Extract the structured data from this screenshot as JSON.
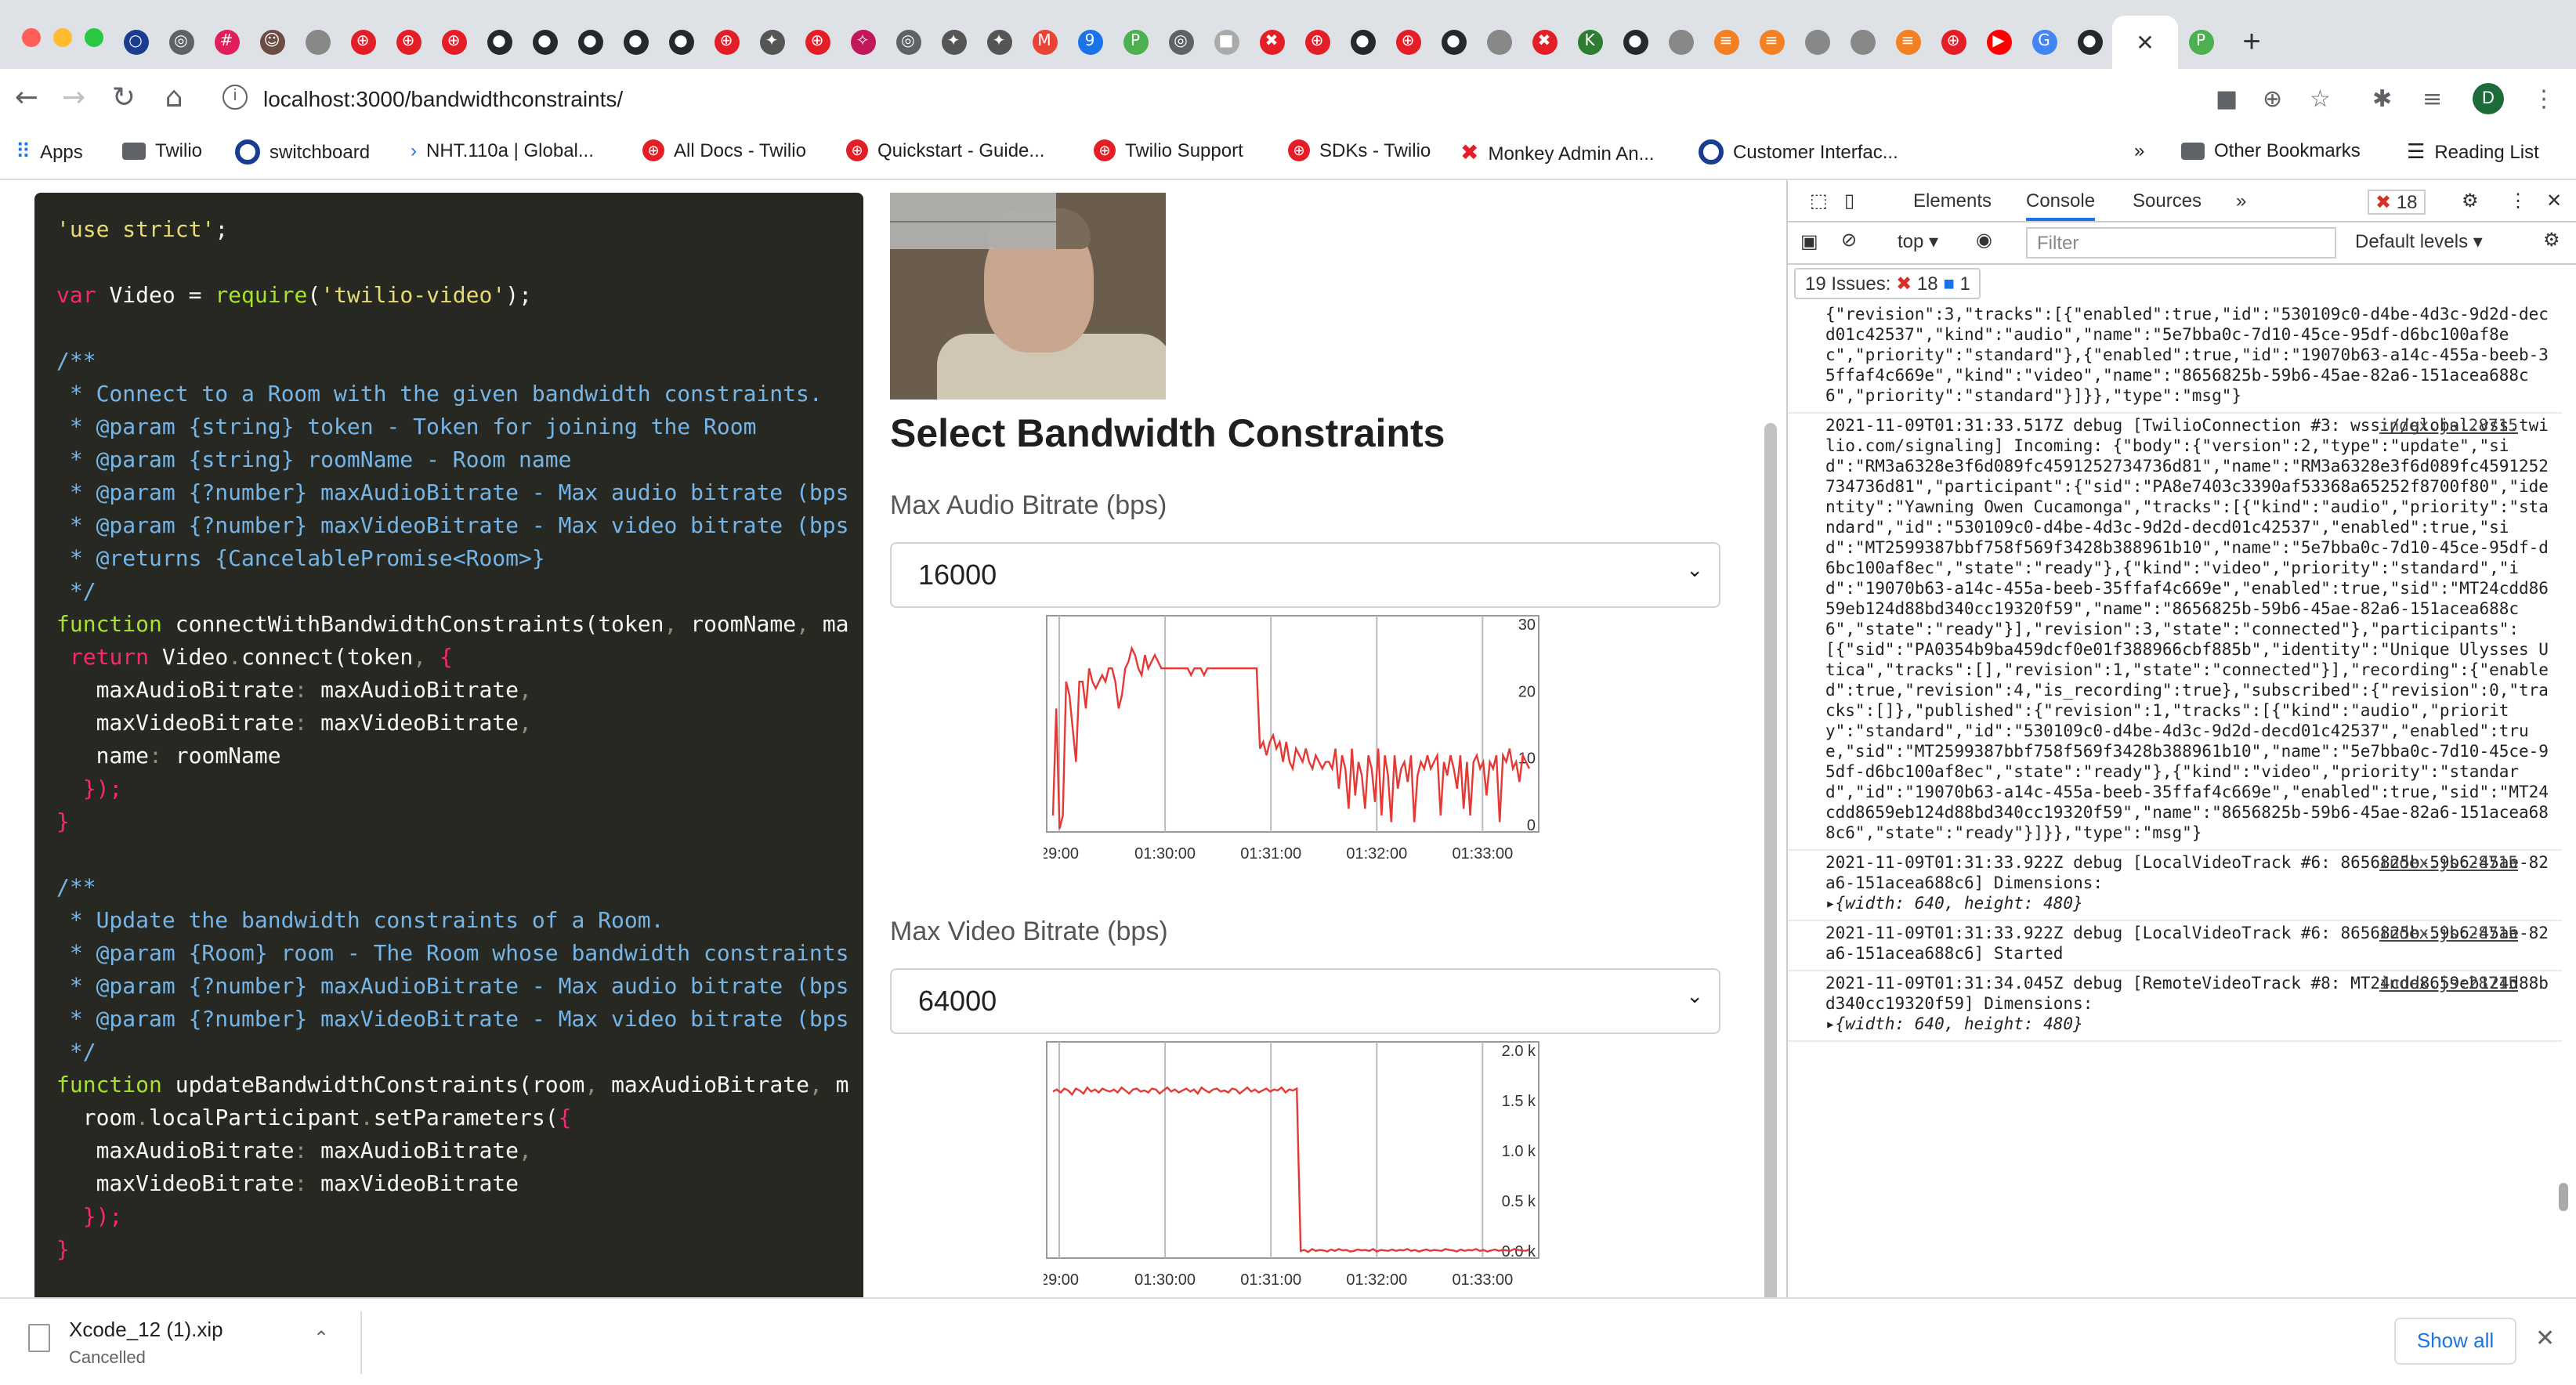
{
  "browser": {
    "tab_count_icons": [
      "obs",
      "chrome",
      "slack",
      "user",
      "apple",
      "twilio",
      "twilio",
      "twilio",
      "github",
      "github",
      "github",
      "github",
      "github",
      "twilio",
      "bird",
      "twilio",
      "pin",
      "chrome",
      "bird",
      "bird",
      "gmail",
      "calendar",
      "p-green",
      "chrome",
      "apple-grey",
      "monkey",
      "twilio",
      "github",
      "twilio",
      "github",
      "apple",
      "monkey",
      "k-green",
      "github",
      "apple",
      "stack",
      "stack",
      "apple",
      "apple",
      "stack",
      "twilio",
      "youtube",
      "google",
      "github",
      "p-green"
    ],
    "active_tab_close": "✕",
    "new_tab": "+",
    "url": "localhost:3000/bandwidthconstraints/",
    "avatar_letter": "D"
  },
  "bookmarks": {
    "items": [
      {
        "label": "Apps",
        "icon": "apps-grid-icon"
      },
      {
        "label": "Twilio",
        "icon": "folder-icon"
      },
      {
        "label": "switchboard",
        "icon": "obs-icon"
      },
      {
        "label": "NHT.110a | Global...",
        "icon": "chevron-icon"
      },
      {
        "label": "All Docs - Twilio",
        "icon": "twilio-icon"
      },
      {
        "label": "Quickstart - Guide...",
        "icon": "twilio-icon"
      },
      {
        "label": "Twilio Support",
        "icon": "twilio-icon"
      },
      {
        "label": "SDKs - Twilio",
        "icon": "twilio-icon"
      },
      {
        "label": "Monkey Admin An...",
        "icon": "monkey-icon"
      },
      {
        "label": "Customer Interfac...",
        "icon": "obs-icon"
      }
    ],
    "overflow": "»",
    "other": "Other Bookmarks",
    "reading_list": "Reading List"
  },
  "code_lines": [
    [
      [
        "c-str",
        "'use strict'"
      ],
      [
        "",
        "; "
      ]
    ],
    [],
    [
      [
        "c-kw",
        "var"
      ],
      [
        "",
        " Video = "
      ],
      [
        "c-fn",
        "require"
      ],
      [
        "",
        "("
      ],
      [
        "c-str",
        "'twilio-video'"
      ],
      [
        "",
        ");"
      ]
    ],
    [],
    [
      [
        "c-cm",
        "/**"
      ]
    ],
    [
      [
        "c-cm",
        " * Connect to a Room with the given bandwidth constraints."
      ]
    ],
    [
      [
        "c-cm",
        " * @param {string} token - Token for joining the Room"
      ]
    ],
    [
      [
        "c-cm",
        " * @param {string} roomName - Room name"
      ]
    ],
    [
      [
        "c-cm",
        " * @param {?number} maxAudioBitrate - Max audio bitrate (bps"
      ]
    ],
    [
      [
        "c-cm",
        " * @param {?number} maxVideoBitrate - Max video bitrate (bps"
      ]
    ],
    [
      [
        "c-cm",
        " * @returns {CancelablePromise<Room>}"
      ]
    ],
    [
      [
        "c-cm",
        " */"
      ]
    ],
    [
      [
        "c-fn",
        "function"
      ],
      [
        "",
        " connectWithBandwidthConstraints("
      ],
      [
        "",
        "token"
      ],
      [
        "c-dim",
        ", "
      ],
      [
        "",
        "roomName"
      ],
      [
        "c-dim",
        ", "
      ],
      [
        "",
        "ma"
      ]
    ],
    [
      [
        "",
        " "
      ],
      [
        "c-kw",
        "return"
      ],
      [
        "",
        " Video"
      ],
      [
        "c-dim",
        "."
      ],
      [
        "",
        "connect("
      ],
      [
        "",
        "token"
      ],
      [
        "c-dim",
        ", "
      ],
      [
        "c-kw",
        "{"
      ]
    ],
    [
      [
        "",
        "   maxAudioBitrate"
      ],
      [
        "c-dim",
        ": "
      ],
      [
        "",
        "maxAudioBitrate"
      ],
      [
        "c-dim",
        ","
      ]
    ],
    [
      [
        "",
        "   maxVideoBitrate"
      ],
      [
        "c-dim",
        ": "
      ],
      [
        "",
        "maxVideoBitrate"
      ],
      [
        "c-dim",
        ","
      ]
    ],
    [
      [
        "",
        "   name"
      ],
      [
        "c-dim",
        ": "
      ],
      [
        "",
        "roomName"
      ]
    ],
    [
      [
        "c-kw",
        "  });"
      ]
    ],
    [
      [
        "c-kw",
        "}"
      ]
    ],
    [],
    [
      [
        "c-cm",
        "/**"
      ]
    ],
    [
      [
        "c-cm",
        " * Update the bandwidth constraints of a Room."
      ]
    ],
    [
      [
        "c-cm",
        " * @param {Room} room - The Room whose bandwidth constraints"
      ]
    ],
    [
      [
        "c-cm",
        " * @param {?number} maxAudioBitrate - Max audio bitrate (bps"
      ]
    ],
    [
      [
        "c-cm",
        " * @param {?number} maxVideoBitrate - Max video bitrate (bps"
      ]
    ],
    [
      [
        "c-cm",
        " */"
      ]
    ],
    [
      [
        "c-fn",
        "function"
      ],
      [
        "",
        " updateBandwidthConstraints("
      ],
      [
        "",
        "room"
      ],
      [
        "c-dim",
        ", "
      ],
      [
        "",
        "maxAudioBitrate"
      ],
      [
        "c-dim",
        ", "
      ],
      [
        "",
        "m"
      ]
    ],
    [
      [
        "",
        "  room"
      ],
      [
        "c-dim",
        "."
      ],
      [
        "",
        "localParticipant"
      ],
      [
        "c-dim",
        "."
      ],
      [
        "",
        "setParameters("
      ],
      [
        "c-kw",
        "{"
      ]
    ],
    [
      [
        "",
        "   maxAudioBitrate"
      ],
      [
        "c-dim",
        ": "
      ],
      [
        "",
        "maxAudioBitrate"
      ],
      [
        "c-dim",
        ","
      ]
    ],
    [
      [
        "",
        "   maxVideoBitrate"
      ],
      [
        "c-dim",
        ": "
      ],
      [
        "",
        "maxVideoBitrate"
      ]
    ],
    [
      [
        "c-kw",
        "  });"
      ]
    ],
    [
      [
        "c-kw",
        "}"
      ]
    ]
  ],
  "page": {
    "heading": "Select Bandwidth Constraints",
    "audio_label": "Max Audio Bitrate (bps)",
    "audio_value": "16000",
    "video_label": "Max Video Bitrate (bps)",
    "video_value": "64000"
  },
  "chart_data": [
    {
      "type": "line",
      "x_ticks": [
        "29:00",
        "01:30:00",
        "01:31:00",
        "01:32:00",
        "01:33:00"
      ],
      "y_ticks": [
        "30",
        "20",
        "10",
        "0"
      ],
      "ylim": [
        0,
        30
      ],
      "color": "#e53935",
      "series": [
        {
          "values": [
            2,
            18,
            0,
            2,
            22,
            20,
            15,
            10,
            22,
            22,
            18,
            24,
            22,
            21,
            22,
            23,
            22,
            24,
            24,
            22,
            18,
            20,
            24,
            25,
            27,
            26,
            24,
            23,
            26,
            24,
            25,
            26,
            25,
            24,
            24,
            24,
            24,
            24,
            24,
            24,
            24,
            24,
            23,
            24,
            24,
            24,
            23,
            24,
            24,
            24,
            24,
            24,
            24,
            24,
            24,
            24,
            24,
            24,
            24,
            24,
            24,
            24,
            24,
            12,
            13,
            11,
            13,
            14,
            12,
            13,
            10,
            13,
            10,
            9,
            12,
            11,
            10,
            12,
            10,
            9,
            11,
            10,
            9,
            10,
            10,
            9,
            12,
            6,
            11,
            9,
            3,
            12,
            5,
            10,
            8,
            3,
            11,
            9,
            4,
            12,
            2,
            11,
            8,
            1,
            11,
            6,
            9,
            10,
            7,
            11,
            1,
            8,
            10,
            9,
            11,
            9,
            10,
            11,
            2,
            10,
            8,
            11,
            9,
            6,
            11,
            3,
            10,
            2,
            10,
            11,
            9,
            10,
            5,
            10,
            9,
            11,
            1,
            11,
            10,
            12,
            9,
            10,
            7,
            11,
            10,
            9
          ]
        }
      ]
    },
    {
      "type": "line",
      "x_ticks": [
        "29:00",
        "01:30:00",
        "01:31:00",
        "01:32:00",
        "01:33:00"
      ],
      "y_ticks": [
        "2.0 k",
        "1.5 k",
        "1.0 k",
        "0.5 k",
        "0.0 k"
      ],
      "ylim": [
        0,
        2000
      ],
      "color": "#e53935",
      "series": [
        {
          "values": [
            1630,
            1650,
            1620,
            1660,
            1640,
            1600,
            1660,
            1640,
            1610,
            1670,
            1630,
            1650,
            1620,
            1660,
            1640,
            1630,
            1650,
            1620,
            1670,
            1640,
            1610,
            1650,
            1660,
            1630,
            1640,
            1620,
            1660,
            1650,
            1610,
            1640,
            1670,
            1630,
            1650,
            1620,
            1640,
            1660,
            1630,
            1650,
            1610,
            1670,
            1640,
            1620,
            1650,
            1660,
            1630,
            1640,
            1620,
            1660,
            1650,
            1610,
            1640,
            1670,
            1630,
            1650,
            1620,
            1640,
            1660,
            1630,
            1650,
            1640,
            1670,
            1620,
            1650,
            1640,
            1660,
            40,
            50,
            30,
            60,
            40,
            50,
            45,
            35,
            55,
            40,
            60,
            45,
            50,
            35,
            40,
            55,
            45,
            50,
            40,
            60,
            35,
            50,
            45,
            40,
            55,
            40,
            50,
            45,
            60,
            40,
            50,
            35,
            45,
            55,
            40,
            50,
            45,
            40,
            60,
            50,
            45,
            35,
            55,
            40,
            50,
            45,
            60,
            40,
            50,
            35,
            45,
            55,
            40,
            50,
            45,
            40,
            60,
            50,
            45,
            40,
            55
          ]
        }
      ]
    }
  ],
  "devtools": {
    "tabs": [
      "Elements",
      "Console",
      "Sources"
    ],
    "active_tab": "Console",
    "more": "»",
    "error_badge": "18",
    "context": "top",
    "filter_placeholder": "Filter",
    "levels": "Default levels",
    "issues_text": "19 Issues:",
    "issues_errors": "18",
    "issues_info": "1",
    "entries": [
      {
        "text": "{\"revision\":3,\"tracks\":[{\"enabled\":true,\"id\":\"530109c0-d4be-4d3c-9d2d-decd01c42537\",\"kind\":\"audio\",\"name\":\"5e7bba0c-7d10-45ce-95df-d6bc100af8ec\",\"priority\":\"standard\"},{\"enabled\":true,\"id\":\"19070b63-a14c-455a-beeb-35ffaf4c669e\",\"kind\":\"video\",\"name\":\"8656825b-59b6-45ae-82a6-151acea688c6\",\"priority\":\"standard\"}]}},\"type\":\"msg\"}",
        "src": ""
      },
      {
        "text": "2021-11-09T01:31:33.517Z debug [TwilioConnection #3: wss://global.vss.twilio.com/signaling] Incoming: {\"body\":{\"version\":2,\"type\":\"update\",\"sid\":\"RM3a6328e3f6d089fc4591252734736d81\",\"name\":\"RM3a6328e3f6d089fc4591252734736d81\",\"participant\":{\"sid\":\"PA8e7403c3390af53368a65252f8700f80\",\"identity\":\"Yawning Owen Cucamonga\",\"tracks\":[{\"kind\":\"audio\",\"priority\":\"standard\",\"id\":\"530109c0-d4be-4d3c-9d2d-decd01c42537\",\"enabled\":true,\"sid\":\"MT2599387bbf758f569f3428b388961b10\",\"name\":\"5e7bba0c-7d10-45ce-95df-d6bc100af8ec\",\"state\":\"ready\"},{\"kind\":\"video\",\"priority\":\"standard\",\"id\":\"19070b63-a14c-455a-beeb-35ffaf4c669e\",\"enabled\":true,\"sid\":\"MT24cdd8659eb124d88bd340cc19320f59\",\"name\":\"8656825b-59b6-45ae-82a6-151acea688c6\",\"state\":\"ready\"}],\"revision\":3,\"state\":\"connected\"},\"participants\":[{\"sid\":\"PA0354b9ba459dcf0e01f388966cbf885b\",\"identity\":\"Unique Ulysses Utica\",\"tracks\":[],\"revision\":1,\"state\":\"connected\"}],\"recording\":{\"enabled\":true,\"revision\":4,\"is_recording\":true},\"subscribed\":{\"revision\":0,\"tracks\":[]},\"published\":{\"revision\":1,\"tracks\":[{\"kind\":\"audio\",\"priority\":\"standard\",\"id\":\"530109c0-d4be-4d3c-9d2d-decd01c42537\",\"enabled\":true,\"sid\":\"MT2599387bbf758f569f3428b388961b10\",\"name\":\"5e7bba0c-7d10-45ce-95df-d6bc100af8ec\",\"state\":\"ready\"},{\"kind\":\"video\",\"priority\":\"standard\",\"id\":\"19070b63-a14c-455a-beeb-35ffaf4c669e\",\"enabled\":true,\"sid\":\"MT24cdd8659eb124d88bd340cc19320f59\",\"name\":\"8656825b-59b6-45ae-82a6-151acea688c6\",\"state\":\"ready\"}]}},\"type\":\"msg\"}",
        "src": "index.js:28715"
      },
      {
        "text": "2021-11-09T01:31:33.922Z debug [LocalVideoTrack #6: 8656825b-59b6-45ae-82a6-151acea688c6] Dimensions:",
        "src": "index.js:28715",
        "obj": "{width: 640, height: 480}"
      },
      {
        "text": "2021-11-09T01:31:33.922Z debug [LocalVideoTrack #6: 8656825b-59b6-45ae-82a6-151acea688c6] Started",
        "src": "index.js:28715"
      },
      {
        "text": "2021-11-09T01:31:34.045Z debug [RemoteVideoTrack #8: MT24cdd8659eb124d88bd340cc19320f59] Dimensions:",
        "src": "index.js:28715",
        "obj": "{width: 640, height: 480}"
      }
    ]
  },
  "download": {
    "filename": "Xcode_12 (1).xip",
    "status": "Cancelled",
    "show_all": "Show all"
  }
}
